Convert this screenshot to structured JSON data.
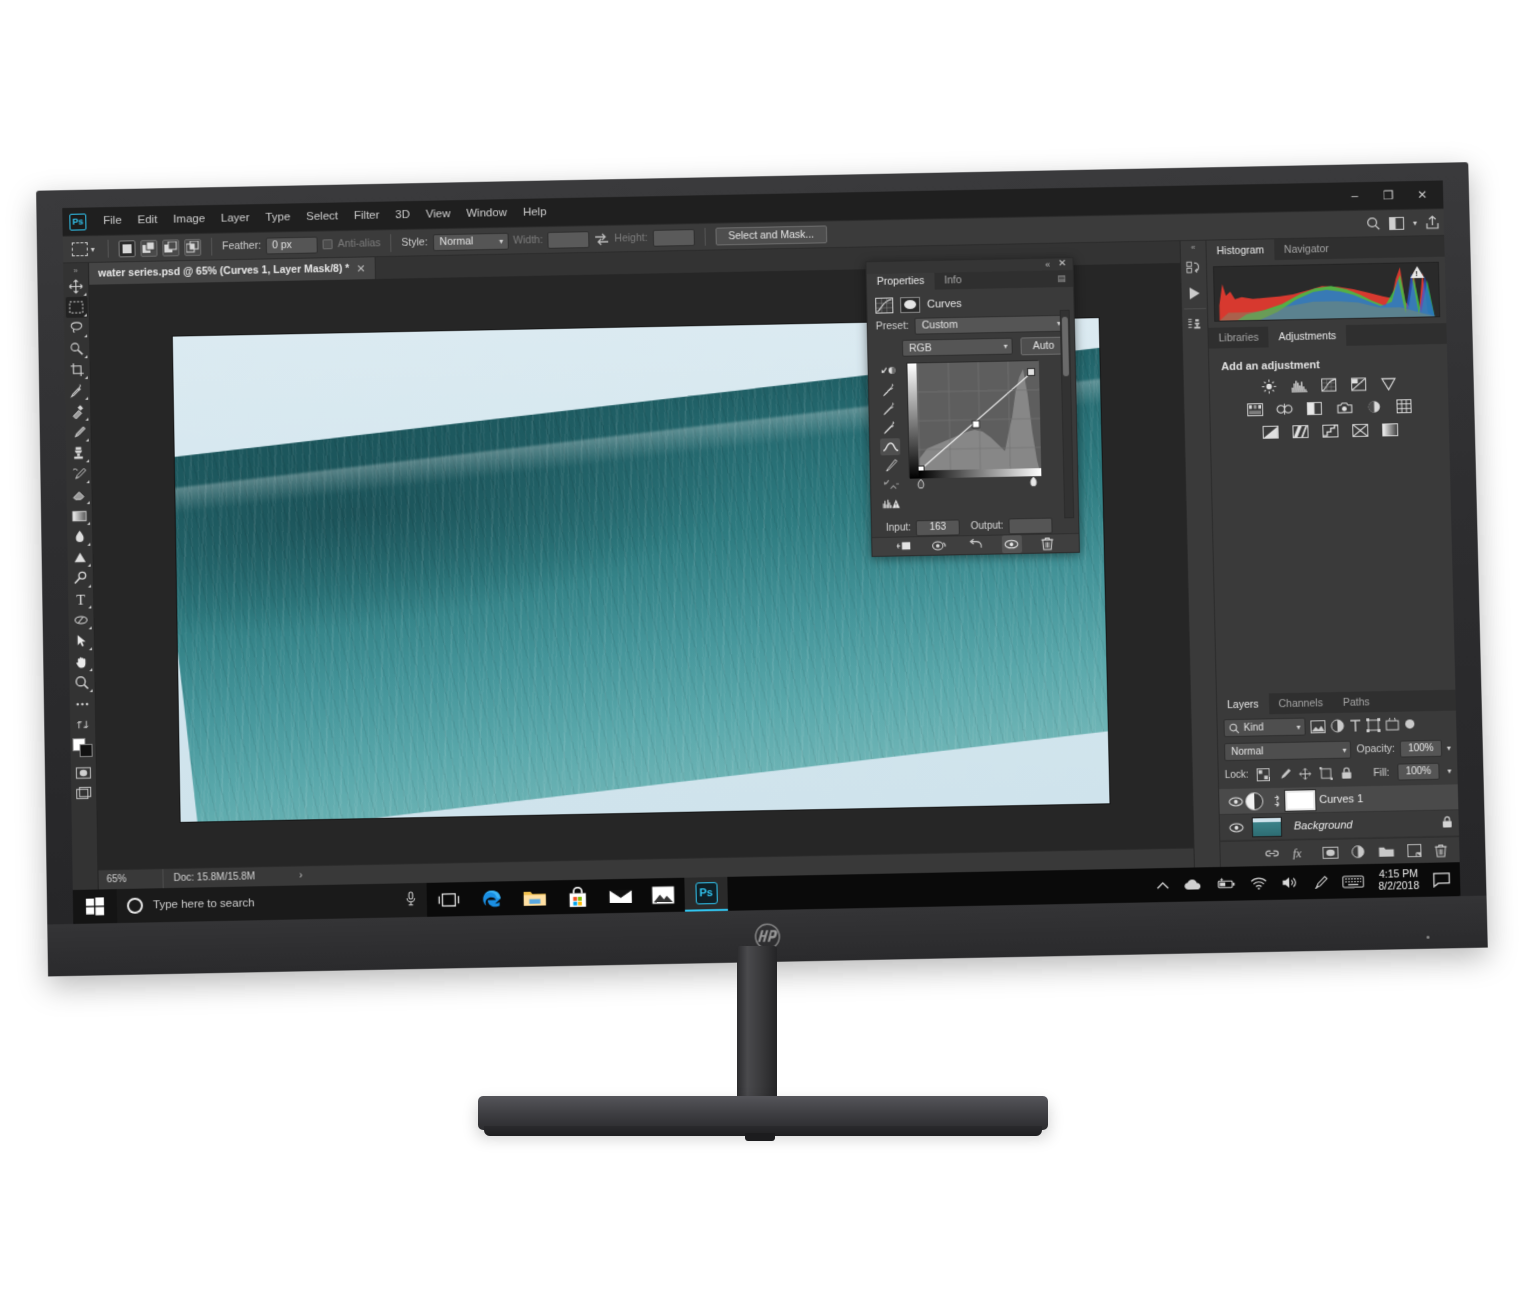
{
  "app": {
    "name": "Adobe Photoshop",
    "logo_text": "Ps"
  },
  "menubar": {
    "items": [
      "File",
      "Edit",
      "Image",
      "Layer",
      "Type",
      "Select",
      "Filter",
      "3D",
      "View",
      "Window",
      "Help"
    ],
    "window_controls": {
      "minimize": "–",
      "restore": "❐",
      "close": "✕"
    }
  },
  "options_bar": {
    "tool": "rectangular-marquee-tool",
    "feather_label": "Feather:",
    "feather_value": "0 px",
    "antialias_label": "Anti-alias",
    "style_label": "Style:",
    "style_value": "Normal",
    "width_label": "Width:",
    "width_value": "",
    "height_label": "Height:",
    "height_value": "",
    "select_and_mask_label": "Select and Mask...",
    "right_icons": [
      "search-icon",
      "arrange-documents-icon",
      "chevron-down-icon",
      "share-icon"
    ]
  },
  "toolbar": {
    "grip": "»",
    "tools": [
      {
        "name": "move-tool",
        "selected": false
      },
      {
        "name": "rectangular-marquee-tool",
        "selected": true
      },
      {
        "name": "lasso-tool",
        "selected": false
      },
      {
        "name": "quick-selection-tool",
        "selected": false
      },
      {
        "name": "crop-tool",
        "selected": false
      },
      {
        "name": "eyedropper-tool",
        "selected": false
      },
      {
        "name": "spot-healing-brush-tool",
        "selected": false
      },
      {
        "name": "brush-tool",
        "selected": false
      },
      {
        "name": "clone-stamp-tool",
        "selected": false
      },
      {
        "name": "history-brush-tool",
        "selected": false
      },
      {
        "name": "eraser-tool",
        "selected": false
      },
      {
        "name": "gradient-tool",
        "selected": false
      },
      {
        "name": "blur-tool",
        "selected": false
      },
      {
        "name": "dodge-tool",
        "selected": false
      },
      {
        "name": "pen-tool",
        "selected": false
      },
      {
        "name": "horizontal-type-tool",
        "selected": false
      },
      {
        "name": "path-selection-tool",
        "selected": false
      },
      {
        "name": "direct-selection-tool",
        "selected": false
      },
      {
        "name": "hand-tool",
        "selected": false
      },
      {
        "name": "zoom-tool",
        "selected": false
      },
      {
        "name": "edit-toolbar-ellipsis",
        "selected": false
      },
      {
        "name": "default-colors-swap",
        "selected": false
      }
    ],
    "foreground_color": "#ffffff",
    "background_color": "#111111",
    "bottom_modes": [
      "quick-mask-mode-icon",
      "screen-mode-icon"
    ]
  },
  "document": {
    "tab_title": "water series.psd @ 65% (Curves 1, Layer Mask/8) *",
    "close_glyph": "✕"
  },
  "status_bar": {
    "zoom": "65%",
    "doc_label": "Doc: 15.8M/15.8M",
    "arrow": "›"
  },
  "properties_panel": {
    "tabs": [
      {
        "label": "Properties",
        "active": true
      },
      {
        "label": "Info",
        "active": false
      }
    ],
    "collapse_glyph": "«",
    "close_glyph": "✕",
    "menu_glyph": "▤",
    "adjustment_title": "Curves",
    "preset_label": "Preset:",
    "preset_value": "Custom",
    "channel_value": "RGB",
    "auto_label": "Auto",
    "input_label": "Input:",
    "input_value": "163",
    "output_label": "Output:",
    "output_value": "",
    "footer_icons": [
      "clip-to-layer-icon",
      "toggle-previous-state-icon",
      "reset-adjustment-icon",
      "toggle-visibility-icon",
      "delete-adjustment-icon"
    ],
    "curve_tools": [
      "on-image-adjust-icon",
      "black-point-eyedropper-icon",
      "gray-point-eyedropper-icon",
      "white-point-eyedropper-icon",
      "curve-point-tool-icon",
      "pencil-draw-curve-icon",
      "smooth-curve-icon",
      "histogram-options-icon"
    ]
  },
  "right_rail": {
    "grip": "«",
    "icons": [
      "history-panel-icon",
      "actions-panel-icon",
      "clone-source-panel-icon"
    ]
  },
  "histogram_panel": {
    "tabs": [
      {
        "label": "Histogram",
        "active": true
      },
      {
        "label": "Navigator",
        "active": false
      }
    ],
    "warning_icon": "clipping-warning-icon"
  },
  "adjustments_panel": {
    "tabs": [
      {
        "label": "Libraries",
        "active": false
      },
      {
        "label": "Adjustments",
        "active": true
      }
    ],
    "title": "Add an adjustment",
    "rows": [
      [
        "brightness-contrast-icon",
        "levels-icon",
        "curves-icon",
        "exposure-icon",
        "vibrance-icon"
      ],
      [
        "hue-saturation-icon",
        "color-balance-icon",
        "black-white-icon",
        "photo-filter-icon",
        "channel-mixer-icon",
        "color-lookup-icon"
      ],
      [
        "invert-icon",
        "posterize-icon",
        "threshold-icon",
        "selective-color-icon",
        "gradient-map-icon"
      ]
    ]
  },
  "layers_panel": {
    "tabs": [
      {
        "label": "Layers",
        "active": true
      },
      {
        "label": "Channels",
        "active": false
      },
      {
        "label": "Paths",
        "active": false
      }
    ],
    "filter_label": "Kind",
    "filter_icons": [
      "pixel-layers-filter-icon",
      "adjustment-layers-filter-icon",
      "type-layers-filter-icon",
      "shape-layers-filter-icon",
      "smart-object-filter-icon",
      "filter-toggle-icon"
    ],
    "blend_mode": "Normal",
    "opacity_label": "Opacity:",
    "opacity_value": "100%",
    "lock_label": "Lock:",
    "lock_icons": [
      "lock-transparent-pixels-icon",
      "lock-image-pixels-icon",
      "lock-position-icon",
      "lock-artboard-nesting-icon",
      "lock-all-icon"
    ],
    "fill_label": "Fill:",
    "fill_value": "100%",
    "layers": [
      {
        "name": "Curves 1",
        "selected": true,
        "visible": true,
        "type": "adjustment",
        "linked": true,
        "locked": false
      },
      {
        "name": "Background",
        "selected": false,
        "visible": true,
        "type": "image",
        "linked": false,
        "locked": true
      }
    ],
    "footer_icons": [
      "link-layers-icon",
      "layer-style-fx-icon",
      "add-layer-mask-icon",
      "new-adjustment-layer-icon",
      "new-group-icon",
      "new-layer-icon",
      "delete-layer-icon"
    ]
  },
  "taskbar": {
    "start_label": "start-button",
    "search_placeholder": "Type here to search",
    "cortana_icon": "cortana-circle-icon",
    "mic_icon": "microphone-icon",
    "apps": [
      {
        "name": "task-view-button",
        "active": false
      },
      {
        "name": "microsoft-edge",
        "active": false
      },
      {
        "name": "file-explorer",
        "active": false
      },
      {
        "name": "microsoft-store",
        "active": false
      },
      {
        "name": "mail",
        "active": false
      },
      {
        "name": "photos",
        "active": false
      },
      {
        "name": "adobe-photoshop",
        "active": true,
        "label": "Ps"
      }
    ],
    "tray_icons": [
      "show-hidden-icons-chevron",
      "onedrive-icon",
      "battery-icon",
      "wifi-icon",
      "volume-icon",
      "pen-workspace-icon",
      "touch-keyboard-icon"
    ],
    "clock_time": "4:15 PM",
    "clock_date": "8/2/2018",
    "action_center_icon": "action-center-icon"
  },
  "hardware": {
    "brand": "HP",
    "device": "hp-monitor"
  },
  "colors": {
    "accent": "#31c5f0",
    "panel_bg": "#3a3a3a",
    "canvas_bg": "#262626",
    "taskbar_bg": "#0a0a0a",
    "water_teal": "#2e7b80",
    "sky_blue": "#d4e7ef"
  }
}
